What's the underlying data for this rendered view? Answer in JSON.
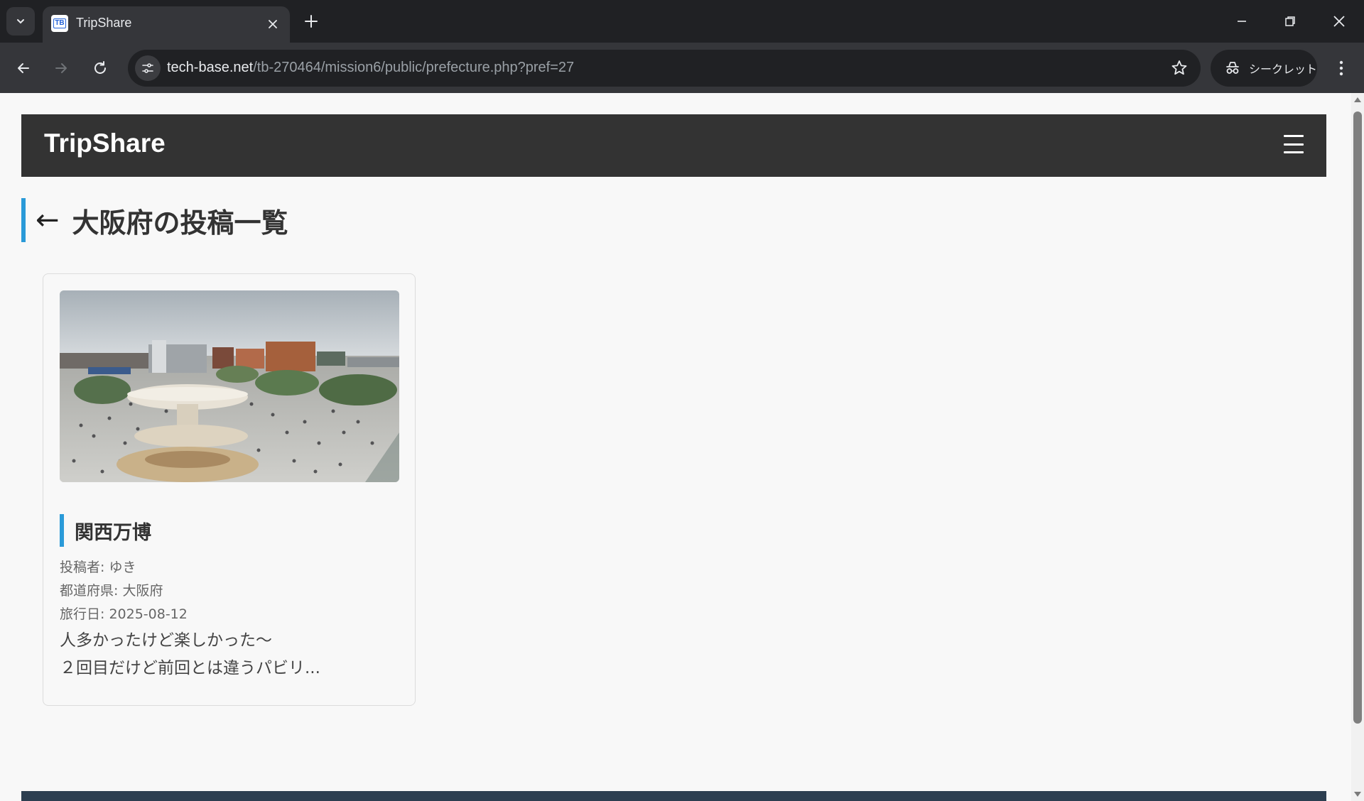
{
  "browser": {
    "tab": {
      "title": "TripShare",
      "favicon_text": "TB"
    },
    "address": {
      "domain": "tech-base.net",
      "path": "/tb-270464/mission6/public/prefecture.php?pref=27"
    },
    "incognito_label": "シークレット",
    "icons": {
      "tab_search": "chevron-down-icon",
      "tab_close": "close-icon",
      "new_tab": "plus-icon",
      "minimize": "minimize-icon",
      "restore": "restore-icon",
      "close_window": "close-icon",
      "back": "arrow-left-icon",
      "forward": "arrow-right-icon",
      "reload": "reload-icon",
      "site_info": "tune-icon",
      "bookmark": "star-icon",
      "incognito": "incognito-icon",
      "menu": "more-vertical-icon"
    }
  },
  "site": {
    "brand": "TripShare",
    "menu_icon": "hamburger-icon"
  },
  "page": {
    "back_arrow": "←",
    "title": "大阪府の投稿一覧",
    "accent_color": "#2a9ad8"
  },
  "posts": [
    {
      "title": "関西万博",
      "author": "投稿者: ゆき",
      "prefecture": "都道府県: 大阪府",
      "date": "旅行日: 2025-08-12",
      "excerpt_line1": "人多かったけど楽しかった〜",
      "excerpt_line2": "２回目だけど前回とは違うパビリ..."
    }
  ]
}
